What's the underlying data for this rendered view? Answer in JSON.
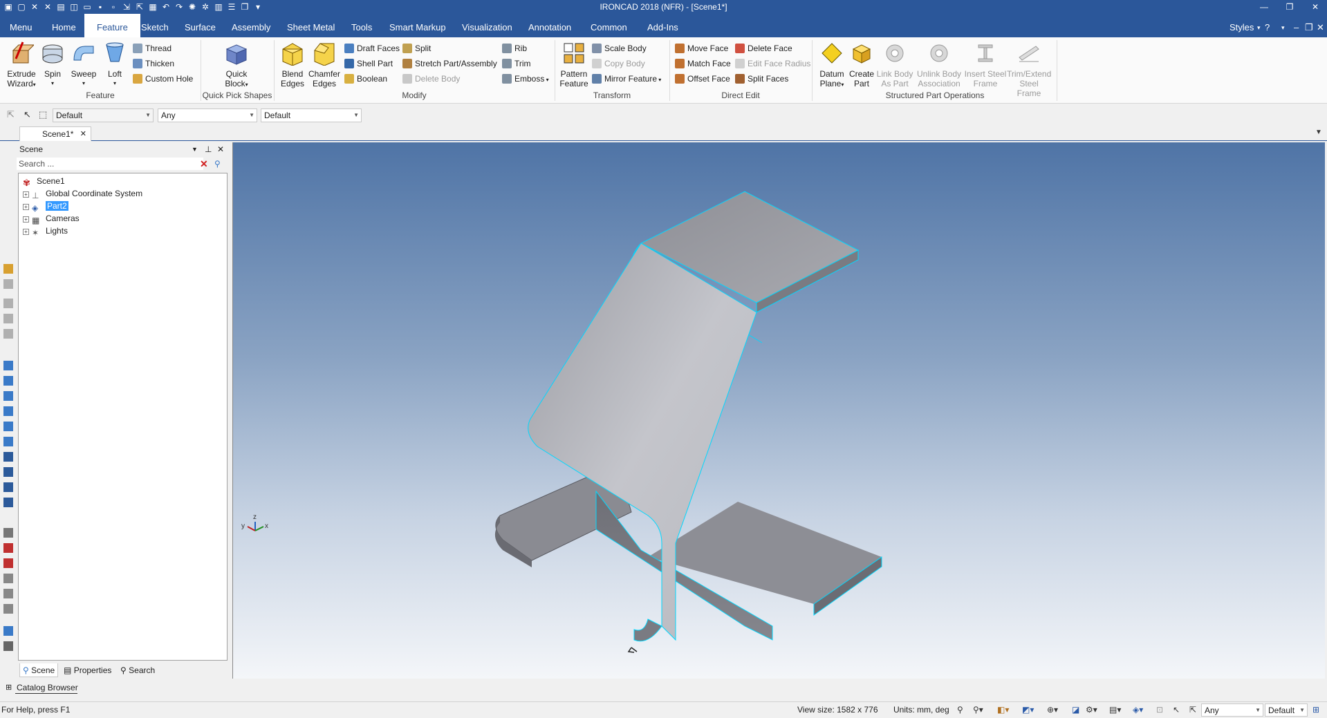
{
  "app": {
    "title": "IRONCAD 2018 (NFR) - [Scene1*]"
  },
  "tabs": [
    {
      "label": "Menu"
    },
    {
      "label": "Home"
    },
    {
      "label": "Feature"
    },
    {
      "label": "Sketch"
    },
    {
      "label": "Surface"
    },
    {
      "label": "Assembly"
    },
    {
      "label": "Sheet Metal"
    },
    {
      "label": "Tools"
    },
    {
      "label": "Smart Markup"
    },
    {
      "label": "Visualization"
    },
    {
      "label": "Annotation"
    },
    {
      "label": "Common"
    },
    {
      "label": "Add-Ins"
    }
  ],
  "styles_label": "Styles",
  "ribbon": {
    "feature": {
      "label": "Feature",
      "extrude": "Extrude",
      "extrude2": "Wizard",
      "spin": "Spin",
      "sweep": "Sweep",
      "loft": "Loft",
      "thread": "Thread",
      "thicken": "Thicken",
      "custom_hole": "Custom Hole"
    },
    "quick_pick": {
      "label": "Quick Pick Shapes",
      "quick": "Quick",
      "block": "Block"
    },
    "modify": {
      "label": "Modify",
      "blend": "Blend",
      "blend2": "Edges",
      "chamfer": "Chamfer",
      "chamfer2": "Edges",
      "draft_faces": "Draft Faces",
      "shell_part": "Shell Part",
      "boolean": "Boolean",
      "split": "Split",
      "stretch": "Stretch Part/Assembly",
      "delete_body": "Delete Body",
      "rib": "Rib",
      "trim": "Trim",
      "emboss": "Emboss"
    },
    "transform": {
      "label": "Transform",
      "pattern": "Pattern",
      "pattern2": "Feature",
      "scale_body": "Scale Body",
      "copy_body": "Copy Body",
      "mirror_feature": "Mirror Feature"
    },
    "direct_edit": {
      "label": "Direct Edit",
      "move_face": "Move Face",
      "match_face": "Match Face",
      "offset_face": "Offset Face",
      "delete_face": "Delete Face",
      "edit_face_radius": "Edit Face Radius",
      "split_faces": "Split Faces"
    },
    "structured": {
      "label": "Structured Part Operations",
      "datum": "Datum",
      "datum2": "Plane",
      "create": "Create",
      "create2": "Part",
      "link": "Link Body",
      "link2": "As Part",
      "unlink": "Unlink Body",
      "unlink2": "Association",
      "insert": "Insert Steel",
      "insert2": "Frame",
      "trim_extend": "Trim/Extend",
      "trim_extend2": "Steel Frame"
    }
  },
  "toolbar": {
    "combo1": "Default",
    "combo2": "Any",
    "combo3": "Default"
  },
  "doc_tab": "Scene1*",
  "scene": {
    "header": "Scene",
    "search_placeholder": "Search ...",
    "tree": [
      {
        "label": "Scene1"
      },
      {
        "label": "Global Coordinate System"
      },
      {
        "label": "Part2"
      },
      {
        "label": "Cameras"
      },
      {
        "label": "Lights"
      }
    ],
    "tabs": [
      {
        "label": "Scene"
      },
      {
        "label": "Properties"
      },
      {
        "label": "Search"
      }
    ]
  },
  "axis": {
    "z": "z",
    "y": "y",
    "x": "x"
  },
  "catalog_label": "Catalog Browser",
  "status": {
    "help": "For Help, press F1",
    "view_size": "View size: 1582 x  776",
    "units": "Units: mm, deg",
    "combo_any": "Any",
    "combo_default": "Default"
  },
  "colors": {
    "accent": "#2b579a",
    "selection": "#3399ff",
    "edge_highlight": "#00d8ff"
  }
}
